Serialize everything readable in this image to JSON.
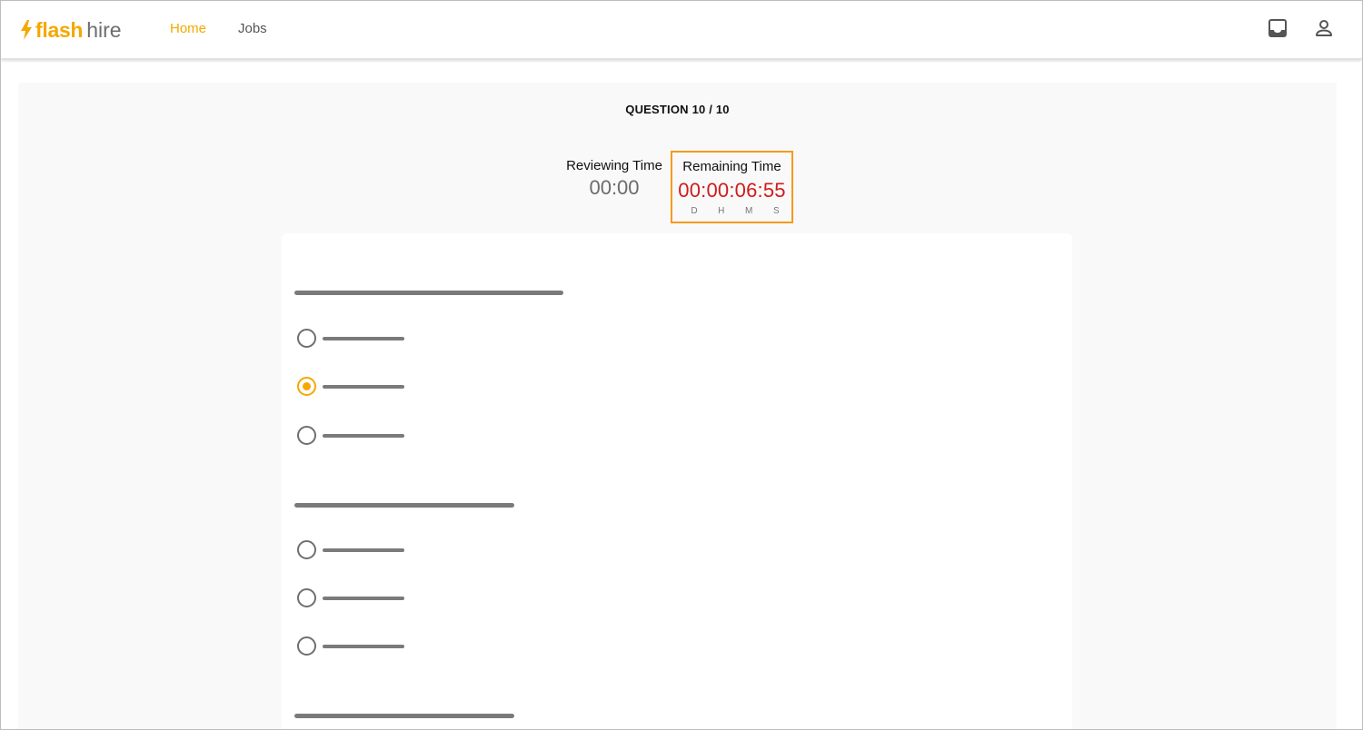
{
  "brand": {
    "part1": "flash",
    "part2": "hire",
    "accent": "#f5a800"
  },
  "nav": {
    "items": [
      {
        "label": "Home",
        "active": true
      },
      {
        "label": "Jobs",
        "active": false
      }
    ]
  },
  "topbar_icons": [
    "inbox-icon",
    "user-icon"
  ],
  "quiz": {
    "counter": "QUESTION 10 / 10",
    "reviewing_time": {
      "label": "Reviewing Time",
      "value": "00:00"
    },
    "remaining_time": {
      "label": "Remaining Time",
      "value": "00:00:06:55",
      "units": [
        "D",
        "H",
        "M",
        "S"
      ],
      "value_color": "#d11a1a",
      "highlight_color": "#f59a1b"
    },
    "questions": [
      {
        "options": [
          {
            "selected": false
          },
          {
            "selected": true
          },
          {
            "selected": false
          }
        ]
      },
      {
        "options": [
          {
            "selected": false
          },
          {
            "selected": false
          },
          {
            "selected": false
          }
        ]
      },
      {
        "options": []
      }
    ]
  }
}
